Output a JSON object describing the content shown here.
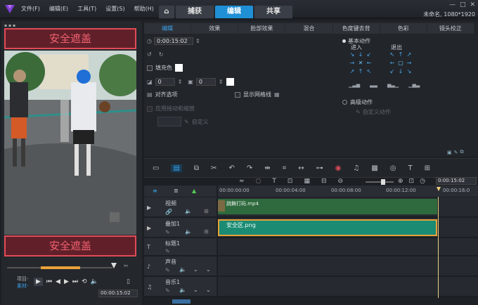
{
  "title_bar": {
    "menu": [
      "文件(F)",
      "编辑(E)",
      "工具(T)",
      "设置(S)",
      "帮助(H)"
    ],
    "tabs": [
      {
        "label": "捕获"
      },
      {
        "label": "编辑"
      },
      {
        "label": "共享"
      }
    ],
    "resolution": "未命名, 1080*1920"
  },
  "preview": {
    "top_mask": "安全遮盖",
    "bottom_mask": "安全遮盖",
    "project_label": "项目-",
    "clip_label": "素材-",
    "timecode": "00:00:15:02"
  },
  "options": {
    "tabs": [
      "编辑",
      "效果",
      "脸部效果",
      "混合",
      "色度键去背",
      "色彩",
      "镜头校正"
    ],
    "duration": "0:00:15:02",
    "fill_color": "填充色",
    "spin1": "0",
    "spin2": "0",
    "align": "对齐选项",
    "show_grid": "显示网格线",
    "stabilize": "应用摇动和缩放",
    "custom_left": "自定义",
    "basic_motion": "基本动作",
    "enter": "进入",
    "exit": "退出",
    "advanced_motion": "高级动作",
    "custom_motion": "自定义动作"
  },
  "timeline": {
    "timecode": "0:00:15:02",
    "ruler": [
      "00:00:00:00",
      "00:00:04:00",
      "00:00:08:00",
      "00:00:12:00",
      "00:00:16:0"
    ],
    "tracks": [
      {
        "name": "视频",
        "clip": "跳舞打码.mp4"
      },
      {
        "name": "叠加1",
        "clip": "安全区.png"
      },
      {
        "name": "标题1",
        "clip": ""
      },
      {
        "name": "声音",
        "clip": ""
      },
      {
        "name": "音乐1",
        "clip": ""
      }
    ]
  }
}
